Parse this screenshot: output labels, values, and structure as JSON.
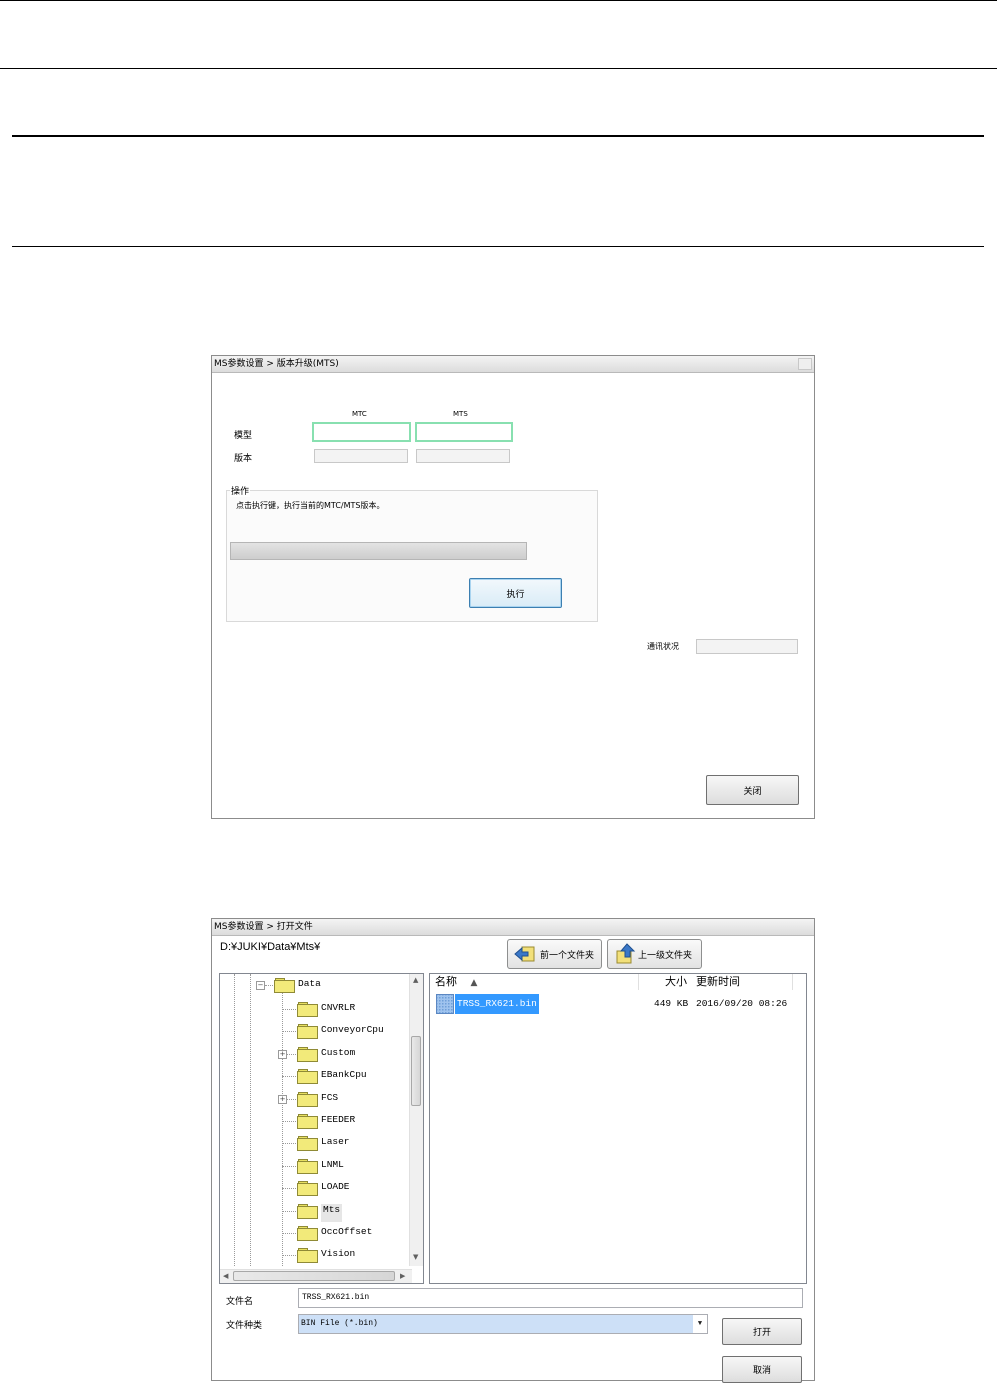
{
  "dialog1": {
    "title": "MS参数设置 > 版本升级(MTS)",
    "col_mtc": "MTC",
    "col_mts": "MTS",
    "row_model": "模型",
    "row_version": "版本",
    "group_title": "操作",
    "instruction": "点击执行键，执行当前的MTC/MTS版本。",
    "execute_label": "执行",
    "comm_status_label": "通讯状况",
    "close_label": "关闭"
  },
  "dialog2": {
    "title": "MS参数设置 > 打开文件",
    "path": "D:¥JUKI¥Data¥Mts¥",
    "back_label": "前一个文件夹",
    "up_label": "上一级文件夹",
    "tree": {
      "root": "Data",
      "items": [
        "CNVRLR",
        "ConveyorCpu",
        "Custom",
        "EBankCpu",
        "FCS",
        "FEEDER",
        "Laser",
        "LNML",
        "LOADE",
        "Mts",
        "OccOffset",
        "Vision"
      ]
    },
    "list": {
      "col_name": "名称",
      "col_size": "大小",
      "col_date": "更新时间",
      "files": [
        {
          "name": "TRSS_RX621.bin",
          "size": "449 KB",
          "date": "2016/09/20 08:26"
        }
      ]
    },
    "filename_label": "文件名",
    "filename_value": "TRSS_RX621.bin",
    "filetype_label": "文件种类",
    "filetype_value": "BIN File (*.bin)",
    "open_label": "打开",
    "cancel_label": "取消"
  }
}
